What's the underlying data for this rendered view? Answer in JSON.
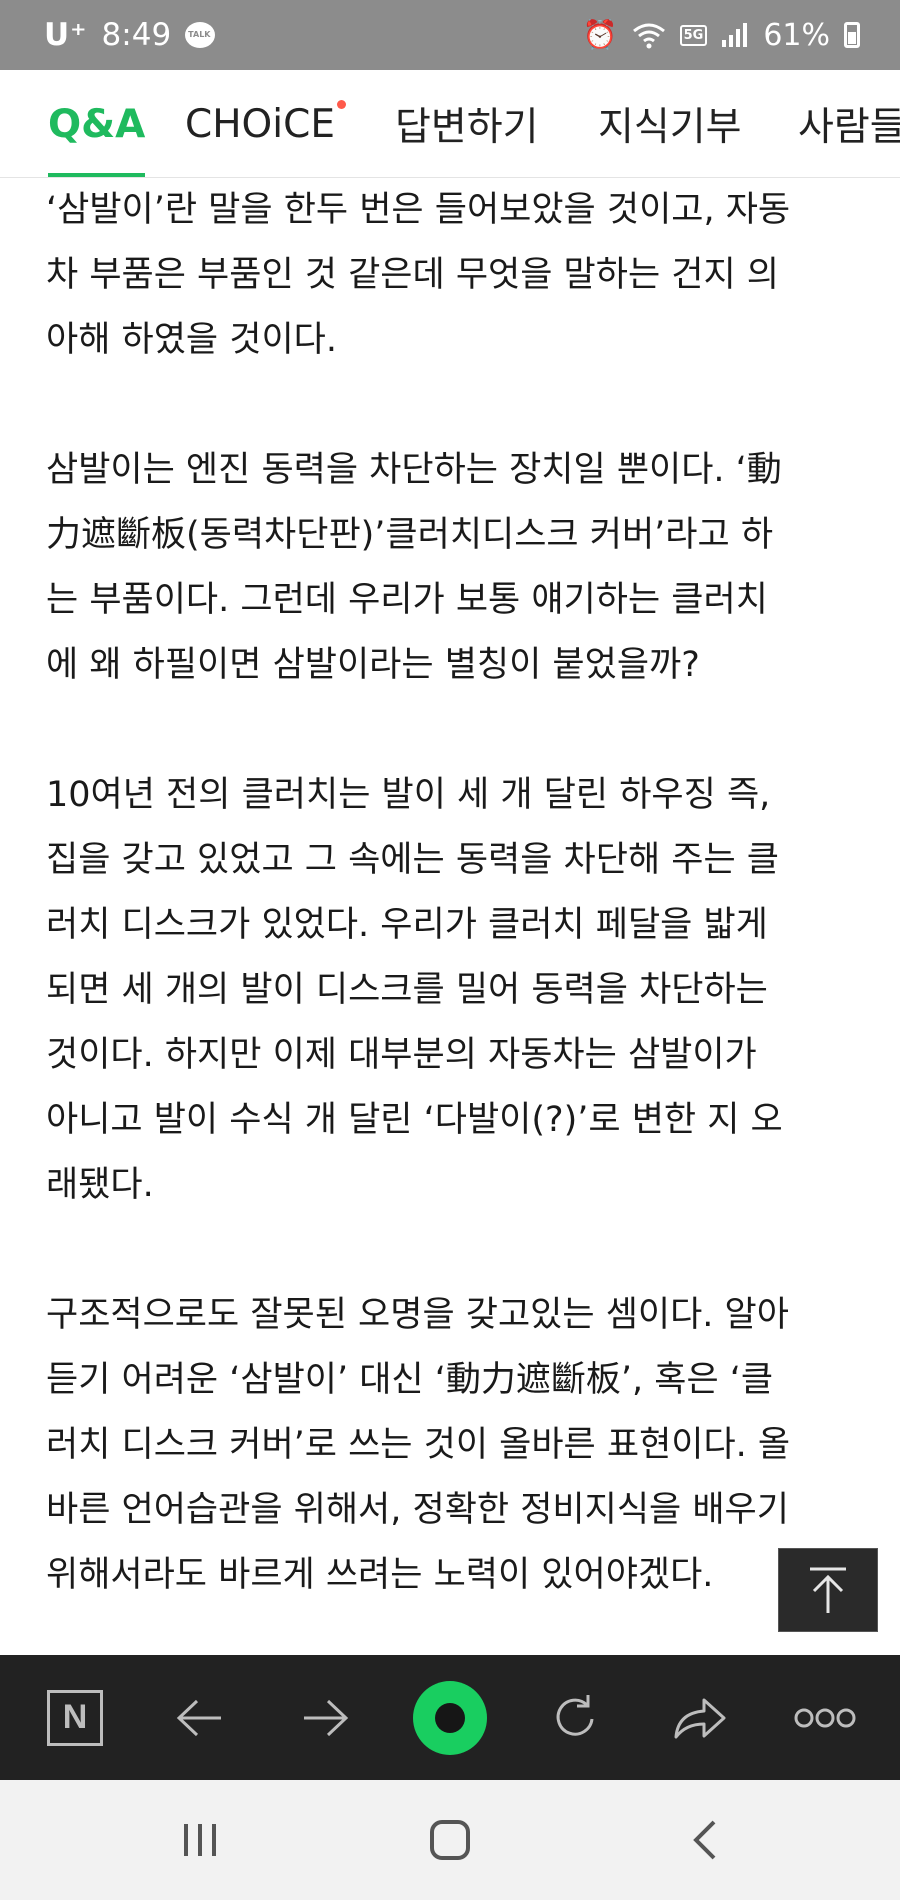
{
  "status_bar": {
    "carrier": "U⁺",
    "time": "8:49",
    "network": "5G",
    "battery": "61%"
  },
  "tabs": [
    {
      "label": "Q&A",
      "active": true
    },
    {
      "label": "CHOiCE",
      "has_dot": true
    },
    {
      "label": "답변하기"
    },
    {
      "label": "지식기부"
    },
    {
      "label": "사람들"
    }
  ],
  "article": {
    "paragraphs": [
      "‘삼발이’란 말을 한두 번은 들어보았을 것이고, 자동\n차 부품은 부품인 것 같은데 무엇을 말하는 건지 의\n아해 하였을 것이다.",
      "삼발이는 엔진 동력을 차단하는 장치일 뿐이다. ‘動\n力遮斷板(동력차단판)’클러치디스크 커버’라고 하\n는 부품이다. 그런데 우리가 보통 얘기하는 클러치\n에 왜 하필이면 삼발이라는 별칭이 붙었을까?",
      "10여년 전의 클러치는 발이 세 개 달린 하우징 즉,\n집을 갖고 있었고 그 속에는 동력을 차단해 주는 클\n러치 디스크가 있었다. 우리가 클러치 페달을 밟게\n되면 세 개의 발이 디스크를 밀어 동력을 차단하는\n것이다. 하지만 이제 대부분의 자동차는 삼발이가\n아니고 발이 수식 개 달린 ‘다발이(?)’로 변한 지 오\n래됐다.",
      "구조적으로도 잘못된 오명을 갖고있는 셈이다. 알아\n듣기 어려운 ‘삼발이’ 대신 ‘動力遮斷板’, 혹은 ‘클\n러치 디스크 커버’로 쓰는 것이 올바른 표현이다. 올\n바른 언어습관을 위해서, 정확한 정비지식을 배우기\n위해서라도 바르게 쓰려는 노력이 있어야겠다."
    ]
  },
  "toolbar": {
    "n_label": "N",
    "icons": [
      "naver-home-icon",
      "back-arrow-icon",
      "forward-arrow-icon",
      "green-dot-icon",
      "refresh-icon",
      "share-icon",
      "more-icon"
    ]
  },
  "navbar": {
    "icons": [
      "recent-apps-icon",
      "home-icon",
      "back-icon"
    ]
  },
  "colors": {
    "accent": "#1fba5e",
    "status_bar": "#8c8c8c",
    "toolbar": "#222222",
    "dot": "#ff5a4b"
  }
}
